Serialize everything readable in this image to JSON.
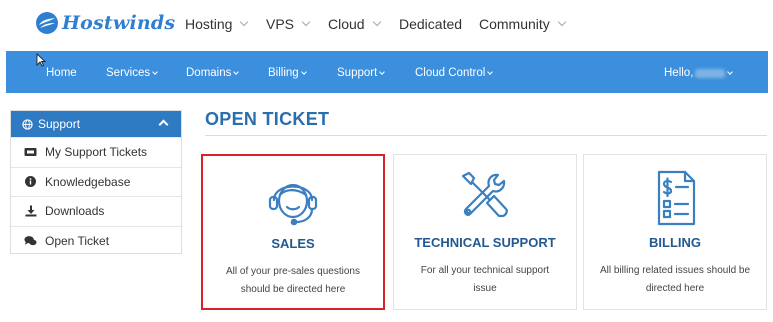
{
  "brand": {
    "name": "Hostwinds"
  },
  "topnav": [
    {
      "label": "Hosting",
      "dropdown": true
    },
    {
      "label": "VPS",
      "dropdown": true
    },
    {
      "label": "Cloud",
      "dropdown": true
    },
    {
      "label": "Dedicated",
      "dropdown": false
    },
    {
      "label": "Community",
      "dropdown": true
    }
  ],
  "mainnav": {
    "items": [
      {
        "label": "Home",
        "dropdown": false
      },
      {
        "label": "Services",
        "dropdown": true
      },
      {
        "label": "Domains",
        "dropdown": true
      },
      {
        "label": "Billing",
        "dropdown": true
      },
      {
        "label": "Support",
        "dropdown": true
      },
      {
        "label": "Cloud Control",
        "dropdown": true
      }
    ],
    "greeting": "Hello,"
  },
  "sidebar": {
    "header": "Support",
    "items": [
      {
        "label": "My Support Tickets",
        "icon": "ticket-icon"
      },
      {
        "label": "Knowledgebase",
        "icon": "info-icon"
      },
      {
        "label": "Downloads",
        "icon": "download-icon"
      },
      {
        "label": "Open Ticket",
        "icon": "comments-icon"
      }
    ]
  },
  "main": {
    "title": "OPEN TICKET",
    "cards": [
      {
        "title": "SALES",
        "description": "All of your pre-sales questions should be directed here",
        "icon": "headset-icon",
        "selected": true
      },
      {
        "title": "TECHNICAL SUPPORT",
        "description": "For all your technical support issue",
        "icon": "tools-icon",
        "selected": false
      },
      {
        "title": "BILLING",
        "description": "All billing related issues should be directed here",
        "icon": "invoice-icon",
        "selected": false
      }
    ]
  },
  "colors": {
    "brand_blue": "#3b8fdc",
    "sidebar_header": "#2e7bc4",
    "heading_blue": "#2a6fad",
    "selected_border": "#d9232a"
  }
}
